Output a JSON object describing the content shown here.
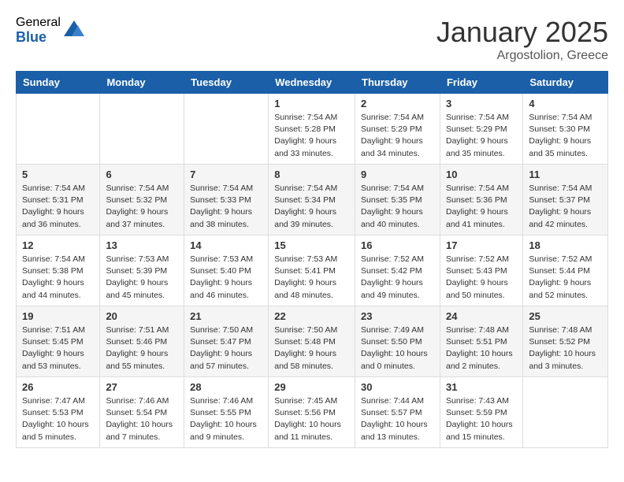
{
  "header": {
    "logo_general": "General",
    "logo_blue": "Blue",
    "month_title": "January 2025",
    "subtitle": "Argostolion, Greece"
  },
  "days_of_week": [
    "Sunday",
    "Monday",
    "Tuesday",
    "Wednesday",
    "Thursday",
    "Friday",
    "Saturday"
  ],
  "weeks": [
    [
      {
        "day": "",
        "info": ""
      },
      {
        "day": "",
        "info": ""
      },
      {
        "day": "",
        "info": ""
      },
      {
        "day": "1",
        "info": "Sunrise: 7:54 AM\nSunset: 5:28 PM\nDaylight: 9 hours\nand 33 minutes."
      },
      {
        "day": "2",
        "info": "Sunrise: 7:54 AM\nSunset: 5:29 PM\nDaylight: 9 hours\nand 34 minutes."
      },
      {
        "day": "3",
        "info": "Sunrise: 7:54 AM\nSunset: 5:29 PM\nDaylight: 9 hours\nand 35 minutes."
      },
      {
        "day": "4",
        "info": "Sunrise: 7:54 AM\nSunset: 5:30 PM\nDaylight: 9 hours\nand 35 minutes."
      }
    ],
    [
      {
        "day": "5",
        "info": "Sunrise: 7:54 AM\nSunset: 5:31 PM\nDaylight: 9 hours\nand 36 minutes."
      },
      {
        "day": "6",
        "info": "Sunrise: 7:54 AM\nSunset: 5:32 PM\nDaylight: 9 hours\nand 37 minutes."
      },
      {
        "day": "7",
        "info": "Sunrise: 7:54 AM\nSunset: 5:33 PM\nDaylight: 9 hours\nand 38 minutes."
      },
      {
        "day": "8",
        "info": "Sunrise: 7:54 AM\nSunset: 5:34 PM\nDaylight: 9 hours\nand 39 minutes."
      },
      {
        "day": "9",
        "info": "Sunrise: 7:54 AM\nSunset: 5:35 PM\nDaylight: 9 hours\nand 40 minutes."
      },
      {
        "day": "10",
        "info": "Sunrise: 7:54 AM\nSunset: 5:36 PM\nDaylight: 9 hours\nand 41 minutes."
      },
      {
        "day": "11",
        "info": "Sunrise: 7:54 AM\nSunset: 5:37 PM\nDaylight: 9 hours\nand 42 minutes."
      }
    ],
    [
      {
        "day": "12",
        "info": "Sunrise: 7:54 AM\nSunset: 5:38 PM\nDaylight: 9 hours\nand 44 minutes."
      },
      {
        "day": "13",
        "info": "Sunrise: 7:53 AM\nSunset: 5:39 PM\nDaylight: 9 hours\nand 45 minutes."
      },
      {
        "day": "14",
        "info": "Sunrise: 7:53 AM\nSunset: 5:40 PM\nDaylight: 9 hours\nand 46 minutes."
      },
      {
        "day": "15",
        "info": "Sunrise: 7:53 AM\nSunset: 5:41 PM\nDaylight: 9 hours\nand 48 minutes."
      },
      {
        "day": "16",
        "info": "Sunrise: 7:52 AM\nSunset: 5:42 PM\nDaylight: 9 hours\nand 49 minutes."
      },
      {
        "day": "17",
        "info": "Sunrise: 7:52 AM\nSunset: 5:43 PM\nDaylight: 9 hours\nand 50 minutes."
      },
      {
        "day": "18",
        "info": "Sunrise: 7:52 AM\nSunset: 5:44 PM\nDaylight: 9 hours\nand 52 minutes."
      }
    ],
    [
      {
        "day": "19",
        "info": "Sunrise: 7:51 AM\nSunset: 5:45 PM\nDaylight: 9 hours\nand 53 minutes."
      },
      {
        "day": "20",
        "info": "Sunrise: 7:51 AM\nSunset: 5:46 PM\nDaylight: 9 hours\nand 55 minutes."
      },
      {
        "day": "21",
        "info": "Sunrise: 7:50 AM\nSunset: 5:47 PM\nDaylight: 9 hours\nand 57 minutes."
      },
      {
        "day": "22",
        "info": "Sunrise: 7:50 AM\nSunset: 5:48 PM\nDaylight: 9 hours\nand 58 minutes."
      },
      {
        "day": "23",
        "info": "Sunrise: 7:49 AM\nSunset: 5:50 PM\nDaylight: 10 hours\nand 0 minutes."
      },
      {
        "day": "24",
        "info": "Sunrise: 7:48 AM\nSunset: 5:51 PM\nDaylight: 10 hours\nand 2 minutes."
      },
      {
        "day": "25",
        "info": "Sunrise: 7:48 AM\nSunset: 5:52 PM\nDaylight: 10 hours\nand 3 minutes."
      }
    ],
    [
      {
        "day": "26",
        "info": "Sunrise: 7:47 AM\nSunset: 5:53 PM\nDaylight: 10 hours\nand 5 minutes."
      },
      {
        "day": "27",
        "info": "Sunrise: 7:46 AM\nSunset: 5:54 PM\nDaylight: 10 hours\nand 7 minutes."
      },
      {
        "day": "28",
        "info": "Sunrise: 7:46 AM\nSunset: 5:55 PM\nDaylight: 10 hours\nand 9 minutes."
      },
      {
        "day": "29",
        "info": "Sunrise: 7:45 AM\nSunset: 5:56 PM\nDaylight: 10 hours\nand 11 minutes."
      },
      {
        "day": "30",
        "info": "Sunrise: 7:44 AM\nSunset: 5:57 PM\nDaylight: 10 hours\nand 13 minutes."
      },
      {
        "day": "31",
        "info": "Sunrise: 7:43 AM\nSunset: 5:59 PM\nDaylight: 10 hours\nand 15 minutes."
      },
      {
        "day": "",
        "info": ""
      }
    ]
  ]
}
